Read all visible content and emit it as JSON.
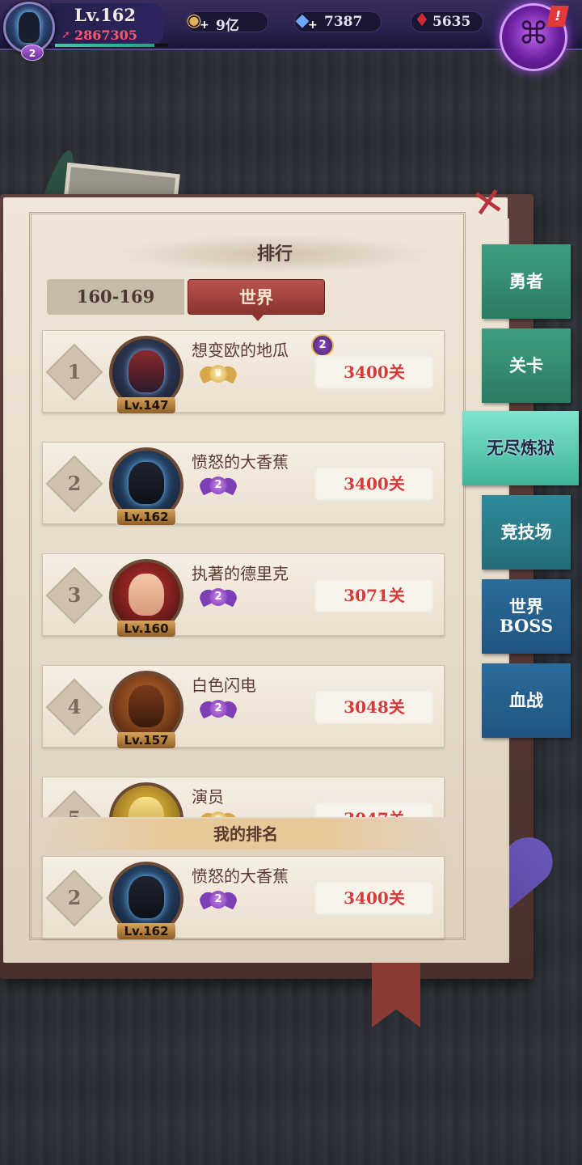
{
  "player": {
    "level": "Lv.162",
    "power": "2867305",
    "rank_badge": "2",
    "xp_progress": 0.88
  },
  "resources": {
    "gold": "9亿",
    "gems": "7387",
    "blood": "5635"
  },
  "alert_mark": "!",
  "panel": {
    "title": "排行",
    "tabs": {
      "range": "160-169",
      "world": "世界"
    },
    "my_rank_label": "我的排名"
  },
  "rankings": [
    {
      "rank": "1",
      "name": "想变欧的地瓜",
      "level": "Lv.147",
      "score": "3400关",
      "badge": "gold",
      "vip": "2"
    },
    {
      "rank": "2",
      "name": "愤怒的大香蕉",
      "level": "Lv.162",
      "score": "3400关",
      "badge": "purple",
      "badge_num": "2"
    },
    {
      "rank": "3",
      "name": "执著的德里克",
      "level": "Lv.160",
      "score": "3071关",
      "badge": "purple",
      "badge_num": "2"
    },
    {
      "rank": "4",
      "name": "白色闪电",
      "level": "Lv.157",
      "score": "3048关",
      "badge": "purple",
      "badge_num": "2"
    },
    {
      "rank": "5",
      "name": "演员",
      "level": "",
      "score": "3047关",
      "badge": "gold"
    }
  ],
  "my_rank": {
    "rank": "2",
    "name": "愤怒的大香蕉",
    "level": "Lv.162",
    "score": "3400关",
    "badge_num": "2"
  },
  "side_tabs": [
    {
      "label": "勇者"
    },
    {
      "label": "关卡"
    },
    {
      "label": "无尽炼狱"
    },
    {
      "label": "竞技场"
    },
    {
      "label": "世界BOSS"
    },
    {
      "label": "血战"
    }
  ],
  "colors": {
    "score_red": "#d63a3a",
    "tab_active": "#8b3330",
    "side_green": "#2b7a62",
    "side_active": "#3fb39a",
    "side_blue": "#1f5480"
  },
  "icons": [
    "gold-coin-icon",
    "diamond-icon",
    "blood-drop-icon",
    "scroll-icon",
    "close-icon",
    "power-icon"
  ]
}
